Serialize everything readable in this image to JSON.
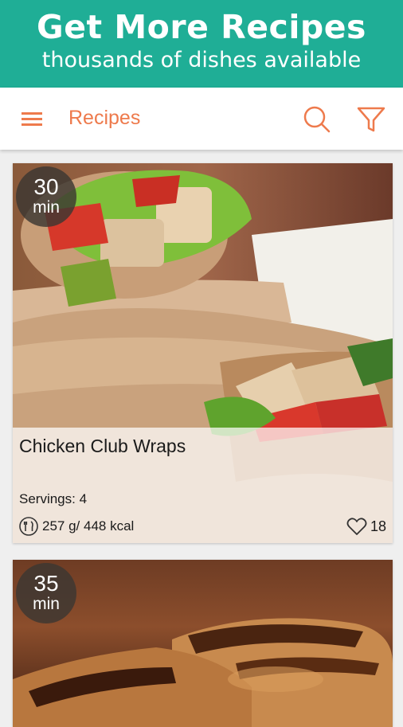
{
  "promo": {
    "title": "Get More Recipes",
    "subtitle": "thousands of dishes available"
  },
  "appbar": {
    "title": "Recipes",
    "accent": "#ee7a4c"
  },
  "recipes": [
    {
      "time": "30",
      "time_unit": "min",
      "title": "Chicken Club Wraps",
      "servings": "Servings: 4",
      "nutrition": "257 g/ 448 kcal",
      "likes": "18"
    },
    {
      "time": "35",
      "time_unit": "min"
    }
  ],
  "colors": {
    "promo_bg": "#1fae96",
    "badge_bg": "#3c3732"
  }
}
